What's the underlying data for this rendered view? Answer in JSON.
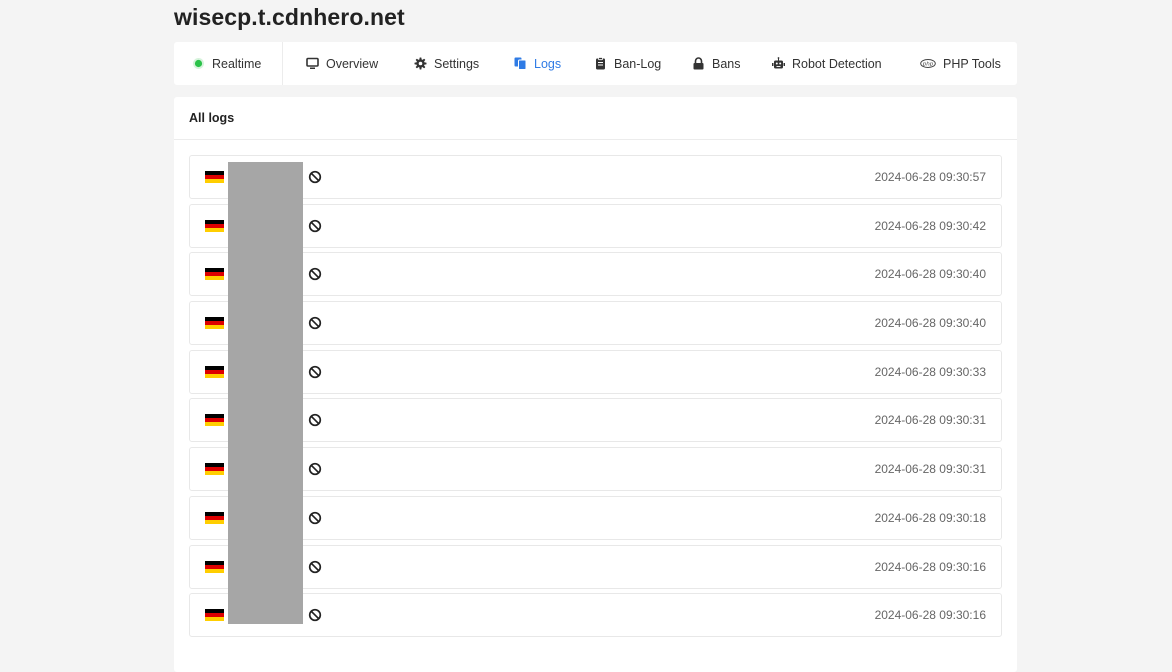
{
  "site": {
    "title": "wisecp.t.cdnhero.net"
  },
  "nav": {
    "items": [
      {
        "label": "Realtime",
        "icon": "live-dot-icon"
      },
      {
        "label": "Overview",
        "icon": "monitor-icon"
      },
      {
        "label": "Settings",
        "icon": "gear-icon"
      },
      {
        "label": "Logs",
        "icon": "files-icon",
        "active": true
      },
      {
        "label": "Ban-Log",
        "icon": "clipboard-icon"
      },
      {
        "label": "Bans",
        "icon": "lock-icon"
      },
      {
        "label": "Robot Detection",
        "icon": "robot-icon"
      },
      {
        "label": "PHP Tools",
        "icon": "php-icon"
      }
    ]
  },
  "logs": {
    "title": "All logs",
    "rows": [
      {
        "country_flag": "germany-flag-icon",
        "status_icon": "ban-icon",
        "timestamp": "2024-06-28 09:30:57"
      },
      {
        "country_flag": "germany-flag-icon",
        "status_icon": "ban-icon",
        "timestamp": "2024-06-28 09:30:42"
      },
      {
        "country_flag": "germany-flag-icon",
        "status_icon": "ban-icon",
        "timestamp": "2024-06-28 09:30:40"
      },
      {
        "country_flag": "germany-flag-icon",
        "status_icon": "ban-icon",
        "timestamp": "2024-06-28 09:30:40"
      },
      {
        "country_flag": "germany-flag-icon",
        "status_icon": "ban-icon",
        "timestamp": "2024-06-28 09:30:33"
      },
      {
        "country_flag": "germany-flag-icon",
        "status_icon": "ban-icon",
        "timestamp": "2024-06-28 09:30:31"
      },
      {
        "country_flag": "germany-flag-icon",
        "status_icon": "ban-icon",
        "timestamp": "2024-06-28 09:30:31"
      },
      {
        "country_flag": "germany-flag-icon",
        "status_icon": "ban-icon",
        "timestamp": "2024-06-28 09:30:18"
      },
      {
        "country_flag": "germany-flag-icon",
        "status_icon": "ban-icon",
        "timestamp": "2024-06-28 09:30:16"
      },
      {
        "country_flag": "germany-flag-icon",
        "status_icon": "ban-icon",
        "timestamp": "2024-06-28 09:30:16"
      }
    ]
  },
  "colors": {
    "accent": "#2f7be5",
    "live": "#2bc24a",
    "flag_black": "#000000",
    "flag_red": "#dd0000",
    "flag_gold": "#ffce00",
    "redaction": "#a6a6a6"
  }
}
